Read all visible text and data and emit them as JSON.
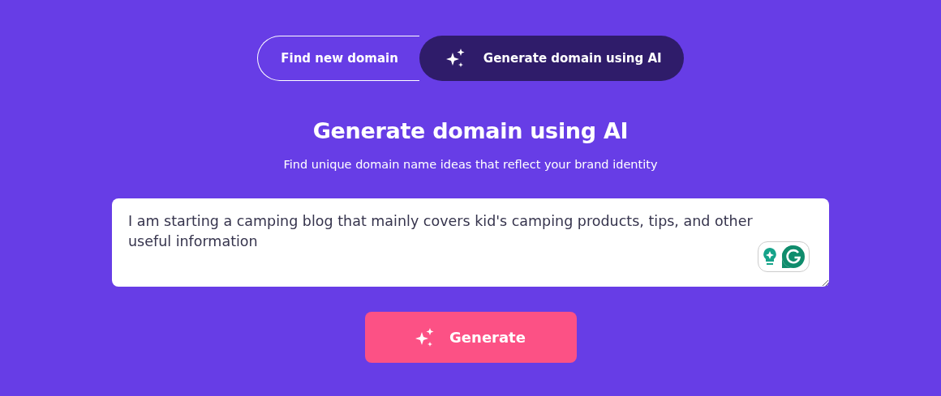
{
  "tabs": [
    {
      "label": "Find new domain",
      "kind": "plain",
      "selected": false
    },
    {
      "label": "Generate domain using AI",
      "kind": "ai",
      "selected": true
    }
  ],
  "heading": "Generate domain using AI",
  "subheading": "Find unique domain name ideas that reflect your brand identity",
  "description_field": {
    "value": "I am starting a camping blog that mainly covers kid's camping products, tips, and other useful information"
  },
  "generate_button": {
    "label": "Generate"
  }
}
